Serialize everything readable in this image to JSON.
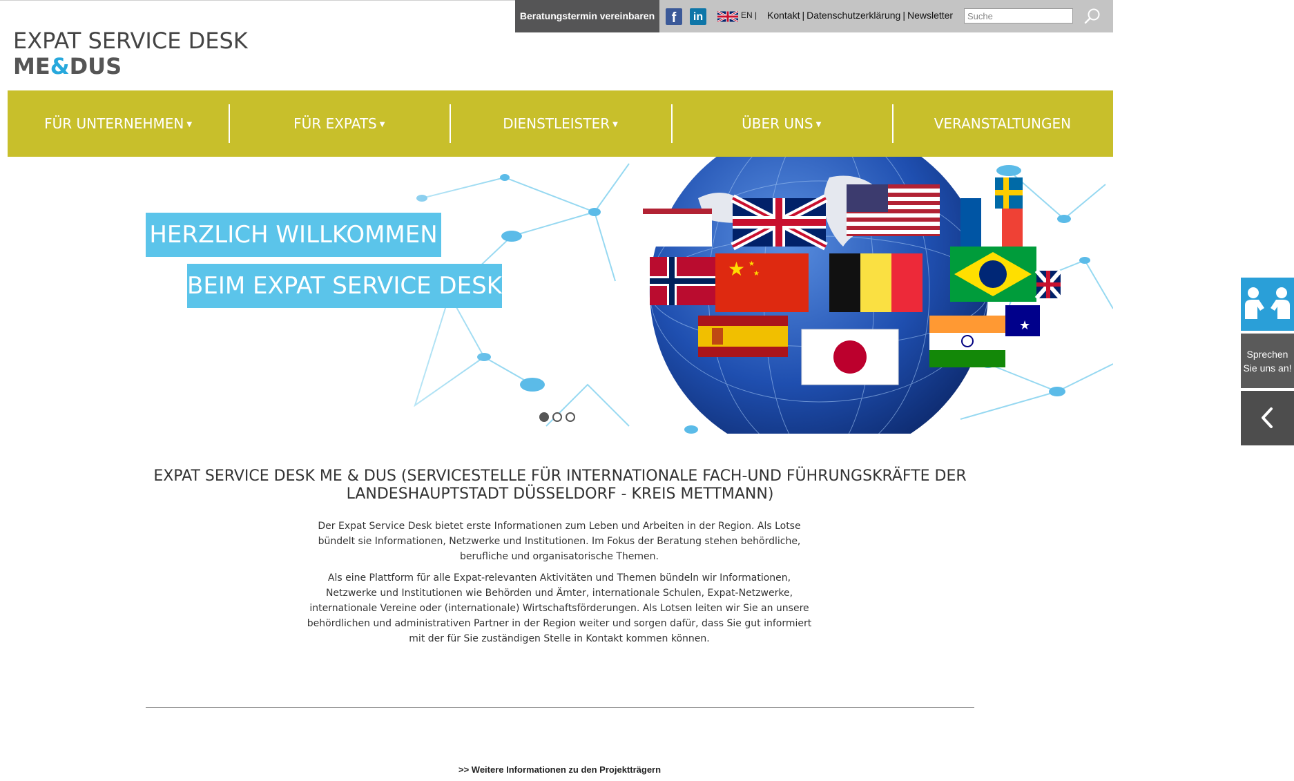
{
  "topbar": {
    "consult_label": "Beratungstermin vereinbaren",
    "facebook_glyph": "f",
    "linkedin_glyph": "in",
    "lang": "EN |",
    "links": [
      "Kontakt",
      "Datenschutzerklärung",
      "Newsletter"
    ],
    "search_placeholder": "Suche",
    "search_value": ""
  },
  "logo": {
    "line1": "EXPAT SERVICE DESK",
    "line2_a": "ME",
    "line2_amp": "&",
    "line2_b": "DUS"
  },
  "nav": [
    {
      "label": "FÜR UNTERNEHMEN",
      "caret": "▼"
    },
    {
      "label": "FÜR EXPATS",
      "caret": "▼"
    },
    {
      "label": "DIENSTLEISTER",
      "caret": "▼"
    },
    {
      "label": "ÜBER UNS",
      "caret": "▼"
    },
    {
      "label": "VERANSTALTUNGEN",
      "caret": ""
    }
  ],
  "hero": {
    "line1": "HERZLICH WILLKOMMEN",
    "line2": "BEIM EXPAT SERVICE DESK",
    "slides": 3,
    "active_slide": 1
  },
  "content": {
    "title": "EXPAT SERVICE DESK ME & DUS (SERVICESTELLE FÜR INTERNATIONALE FACH-UND FÜHRUNGSKRÄFTE DER LANDESHAUPTSTADT DÜSSELDORF - KREIS METTMANN)",
    "para1": "Der Expat Service Desk bietet erste Informationen zum Leben und Arbeiten in der Region. Als Lotse bündelt sie Informationen, Netzwerke und Institutionen. Im Fokus der Beratung stehen behördliche, berufliche und organisatorische Themen.",
    "para2": "Als eine Plattform für alle Expat-relevanten Aktivitäten und Themen bündeln wir Informationen, Netzwerke und Institutionen wie Behörden und Ämter, internationale Schulen, Expat-Netzwerke, internationale Vereine oder (internationale) Wirtschaftsförderungen. Als Lotsen leiten wir Sie an unsere behördlichen und administrativen Partner in der Region weiter und sorgen dafür, dass Sie gut informiert mit der für Sie zuständigen Stelle in Kontakt kommen können.",
    "more_link": ">> Weitere Informationen zu den Projektträgern"
  },
  "side": {
    "text_line1": "Sprechen",
    "text_line2": "Sie uns an!"
  },
  "colors": {
    "nav_bg": "#c8bf2b",
    "accent_blue": "#5bc4ea",
    "topbar_bg": "#c4c4c4",
    "dark_btn": "#555556"
  }
}
